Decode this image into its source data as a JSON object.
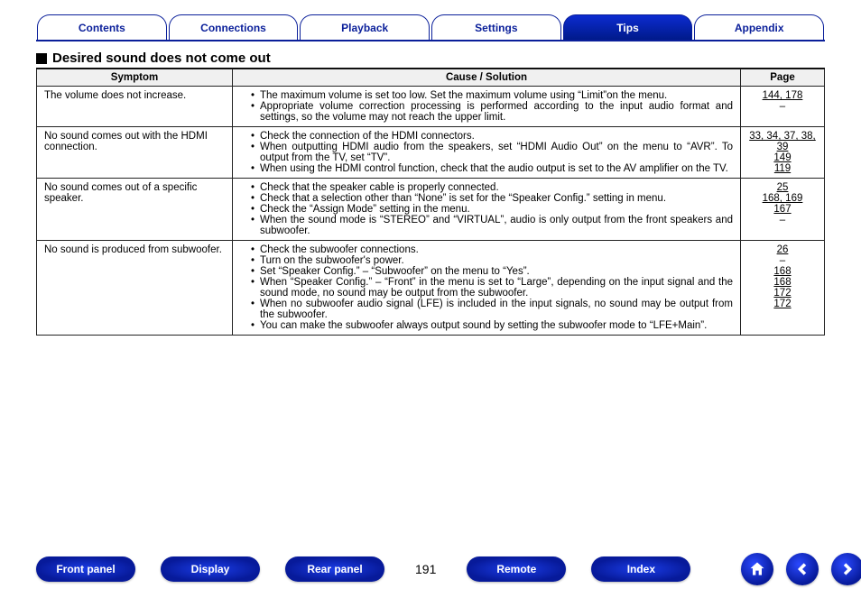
{
  "tabs": {
    "items": [
      "Contents",
      "Connections",
      "Playback",
      "Settings",
      "Tips",
      "Appendix"
    ],
    "activeIndex": 4
  },
  "heading": "Desired sound does not come out",
  "table": {
    "headers": {
      "symptom": "Symptom",
      "cause": "Cause / Solution",
      "page": "Page"
    },
    "rows": [
      {
        "symptom": "The volume does not increase.",
        "causes": [
          "The maximum volume is set too low. Set the maximum volume using “Limit”on the menu.",
          "Appropriate volume correction processing is performed according to the input audio format and settings, so the volume may not reach the upper limit."
        ],
        "pages": [
          "144, 178",
          "–"
        ]
      },
      {
        "symptom": "No sound comes out with the HDMI connection.",
        "causes": [
          "Check the connection of the HDMI connectors.",
          "When outputting HDMI audio from the speakers, set “HDMI Audio Out” on the menu to “AVR”. To output from the TV, set “TV”.",
          "When using the HDMI control function, check that the audio output is set to the AV amplifier on the TV."
        ],
        "pages": [
          "33, 34, 37, 38, 39",
          "149",
          "119"
        ]
      },
      {
        "symptom": "No sound comes out of a specific speaker.",
        "causes": [
          "Check that the speaker cable is properly connected.",
          "Check that a selection other than “None” is set for the “Speaker Config.” setting in menu.",
          "Check the “Assign Mode” setting in the menu.",
          "When the sound mode is “STEREO” and “VIRTUAL”, audio is only output from the front speakers and subwoofer."
        ],
        "pages": [
          "25",
          "168, 169",
          "167",
          "–"
        ]
      },
      {
        "symptom": "No sound is produced from subwoofer.",
        "causes": [
          "Check the subwoofer connections.",
          "Turn on the subwoofer's power.",
          "Set “Speaker Config.” – “Subwoofer” on the menu to “Yes”.",
          "When “Speaker Config.” – “Front” in the menu is set to “Large”, depending on the input signal and the sound mode, no sound may be output from the subwoofer.",
          "When no subwoofer audio signal (LFE) is included in the input signals, no sound may be output from the subwoofer.",
          "You can make the subwoofer always output sound by setting the subwoofer mode to “LFE+Main”."
        ],
        "pages": [
          "26",
          "–",
          "168",
          "168",
          "172",
          "172"
        ]
      }
    ]
  },
  "bottom": {
    "buttons": [
      "Front panel",
      "Display",
      "Rear panel",
      "Remote",
      "Index"
    ],
    "pageNumber": "191",
    "icons": {
      "home": "home-icon",
      "prev": "arrow-left-icon",
      "next": "arrow-right-icon"
    }
  }
}
